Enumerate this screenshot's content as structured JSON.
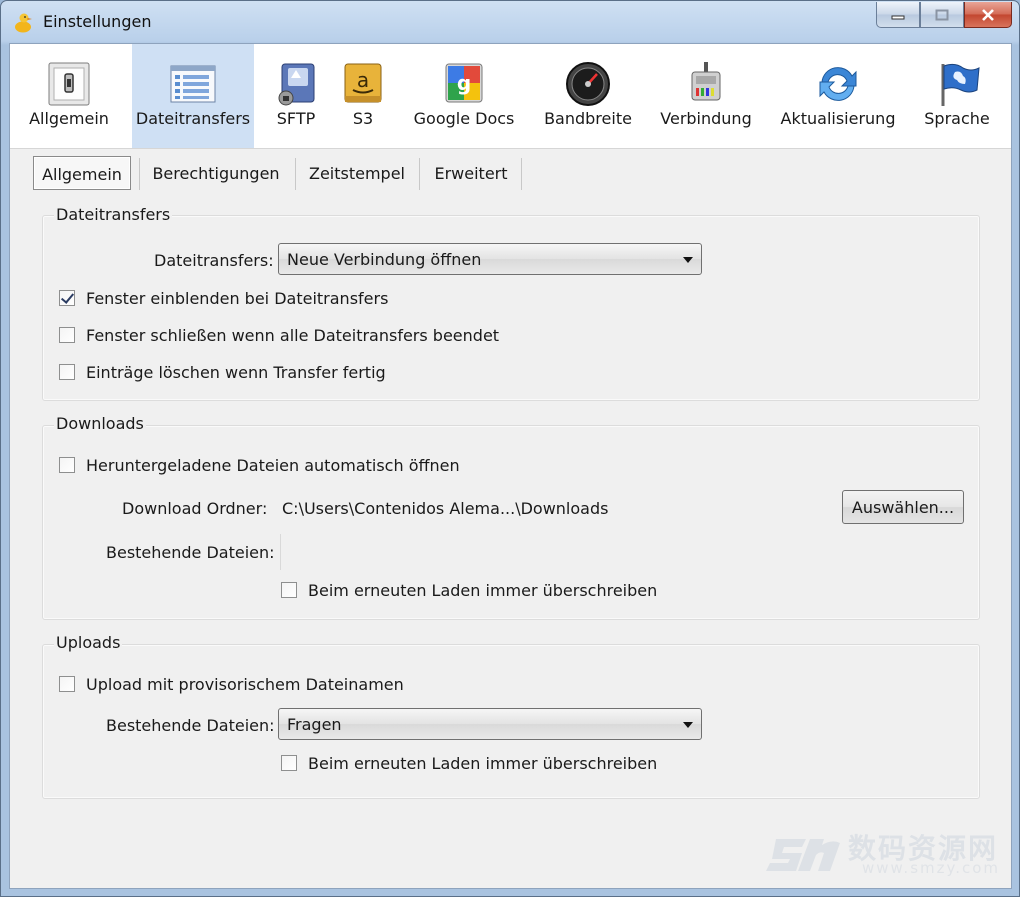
{
  "window": {
    "title": "Einstellungen"
  },
  "toolbar": {
    "items": [
      {
        "label": "Allgemein",
        "icon": "switch-icon"
      },
      {
        "label": "Dateitransfers",
        "icon": "transfer-list-icon"
      },
      {
        "label": "SFTP",
        "icon": "sftp-drive-icon"
      },
      {
        "label": "S3",
        "icon": "amazon-s3-icon"
      },
      {
        "label": "Google Docs",
        "icon": "google-docs-icon"
      },
      {
        "label": "Bandbreite",
        "icon": "speedometer-icon"
      },
      {
        "label": "Verbindung",
        "icon": "network-plug-icon"
      },
      {
        "label": "Aktualisierung",
        "icon": "refresh-icon"
      },
      {
        "label": "Sprache",
        "icon": "flag-icon"
      }
    ],
    "active": "Dateitransfers"
  },
  "tabs": [
    "Allgemein",
    "Berechtigungen",
    "Zeitstempel",
    "Erweitert"
  ],
  "selected_tab": "Allgemein",
  "transfers": {
    "title": "Dateitransfers",
    "mode_label": "Dateitransfers:",
    "mode_value": "Neue Verbindung öffnen",
    "show_window": {
      "label": "Fenster einblenden bei Dateitransfers",
      "checked": true
    },
    "close_window": {
      "label": "Fenster schließen wenn alle Dateitransfers beendet",
      "checked": false
    },
    "remove_entries": {
      "label": "Einträge löschen wenn Transfer fertig",
      "checked": false
    }
  },
  "downloads": {
    "title": "Downloads",
    "auto_open": {
      "label": "Heruntergeladene Dateien automatisch öffnen",
      "checked": false
    },
    "folder_label": "Download Ordner:",
    "folder_value": "C:\\Users\\Contenidos  Alema...\\Downloads",
    "choose_button": "Auswählen...",
    "existing_label": "Bestehende Dateien:",
    "overwrite": {
      "label": "Beim erneuten Laden immer überschreiben",
      "checked": false
    }
  },
  "uploads": {
    "title": "Uploads",
    "temp_name": {
      "label": "Upload mit provisorischem Dateinamen",
      "checked": false
    },
    "existing_label": "Bestehende Dateien:",
    "existing_value": "Fragen",
    "overwrite": {
      "label": "Beim erneuten Laden immer überschreiben",
      "checked": false
    }
  },
  "watermark": {
    "text": "数码资源网",
    "url": "www.smzy.com"
  },
  "colors": {
    "active_toolbar": "#cfe0f4",
    "dialog_bg": "#f0f0f0",
    "title_bar": "#b9d0ea"
  }
}
